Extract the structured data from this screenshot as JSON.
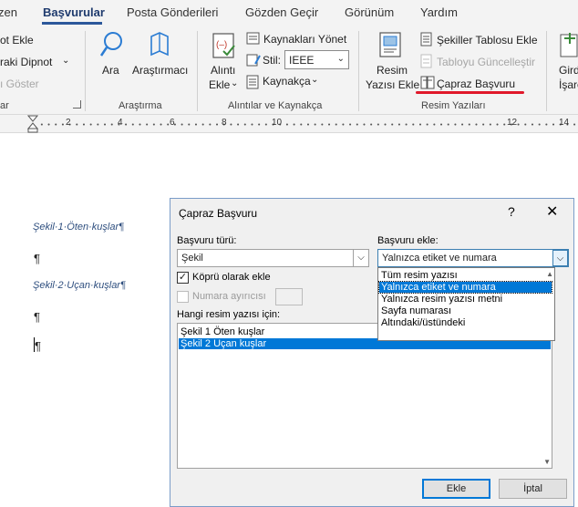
{
  "ribbon_tabs": [
    {
      "label": "zen"
    },
    {
      "label": "Başvurular"
    },
    {
      "label": "Posta Gönderileri"
    },
    {
      "label": "Gözden Geçir"
    },
    {
      "label": "Görünüm"
    },
    {
      "label": "Yardım"
    }
  ],
  "ribbon": {
    "footnotes": {
      "insert_footnote": "ot Ekle",
      "next_footnote": "raki Dipnot",
      "show_notes": "ı Göster",
      "group": "ar"
    },
    "research": {
      "search": "Ara",
      "researcher": "Araştırmacı",
      "group": "Araştırma"
    },
    "citations": {
      "insert_citation_1": "Alıntı",
      "insert_citation_2": "Ekle",
      "manage_sources": "Kaynakları Yönet",
      "style_label": "Stil:",
      "style_value": "IEEE",
      "bibliography": "Kaynakça",
      "group": "Alıntılar ve Kaynakça"
    },
    "captions": {
      "insert_caption_1": "Resim",
      "insert_caption_2": "Yazısı Ekle",
      "insert_table_of_figures": "Şekiller Tablosu Ekle",
      "update_table": "Tabloyu Güncelleştir",
      "cross_reference": "Çapraz Başvuru",
      "group": "Resim Yazıları"
    },
    "index": {
      "mark_1": "Gird",
      "mark_2": "İşare"
    }
  },
  "ruler": {
    "numbers": [
      "2",
      "4",
      "6",
      "8",
      "10",
      "12",
      "14"
    ]
  },
  "document": {
    "caption1": "Şekil·1·Öten·kuşlar¶",
    "caption2": "Şekil·2·Uçan·kuşlar¶",
    "pilcrow": "¶"
  },
  "dialog": {
    "title": "Çapraz Başvuru",
    "help": "?",
    "close": "✕",
    "ref_type_label": "Başvuru türü:",
    "ref_type_value": "Şekil",
    "insert_ref_label": "Başvuru ekle:",
    "insert_ref_value": "Yalnızca etiket ve numara",
    "hyperlink_label": "Köprü olarak ekle",
    "hyperlink_checked": "✓",
    "separator_label": "Numara ayırıcısı",
    "for_which_label": "Hangi resim yazısı için:",
    "caption_items": [
      "Şekil 1 Öten kuşlar",
      "Şekil 2 Uçan kuşlar"
    ],
    "dropdown_options": [
      "Tüm resim yazısı",
      "Yalnızca etiket ve numara",
      "Yalnızca resim yazısı metni",
      "Sayfa numarası",
      "Altındaki/üstündeki"
    ],
    "insert_button": "Ekle",
    "cancel_button": "İptal"
  }
}
